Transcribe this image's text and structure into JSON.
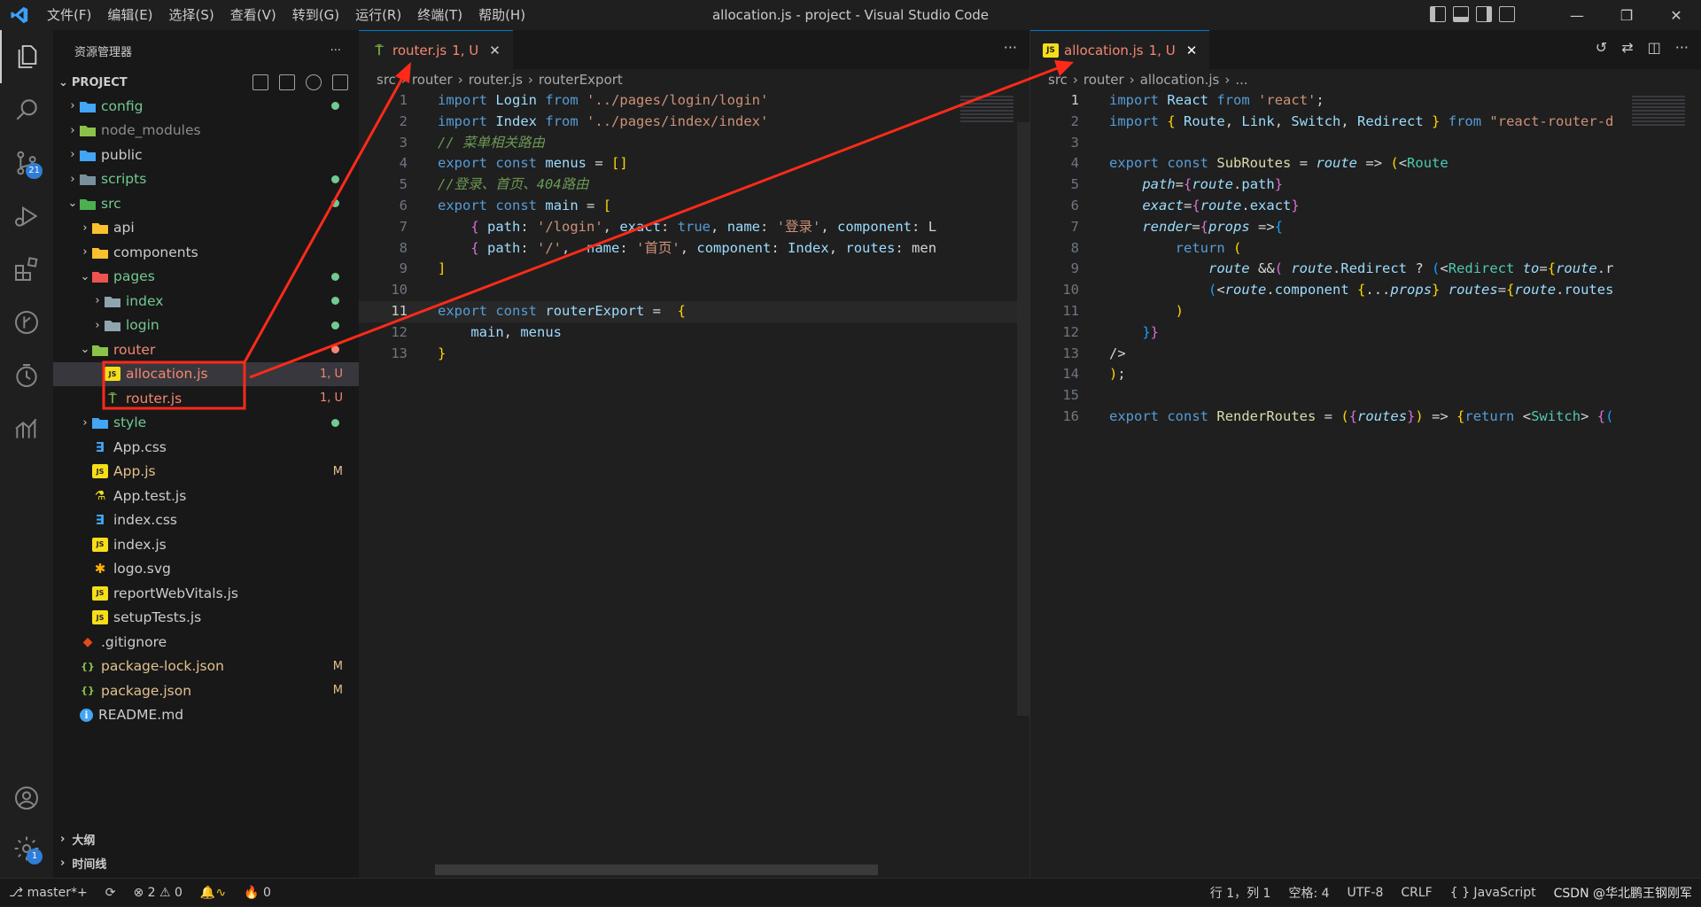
{
  "window": {
    "title": "allocation.js - project - Visual Studio Code"
  },
  "menu": [
    "文件(F)",
    "编辑(E)",
    "选择(S)",
    "查看(V)",
    "转到(G)",
    "运行(R)",
    "终端(T)",
    "帮助(H)"
  ],
  "activity": {
    "scm_badge": "21",
    "settings_badge": "1"
  },
  "sidebar": {
    "header": "资源管理器",
    "more": "···",
    "project": "PROJECT",
    "tree": [
      {
        "label": "config",
        "depth": 0,
        "kind": "folder",
        "open": false,
        "color": "#73c991",
        "icon_color": "#42a5f5",
        "status": "dot",
        "status_color": "#73c991"
      },
      {
        "label": "node_modules",
        "depth": 0,
        "kind": "folder",
        "open": false,
        "color": "#8b8b8b",
        "icon_color": "#8bc34a",
        "status": "",
        "status_color": ""
      },
      {
        "label": "public",
        "depth": 0,
        "kind": "folder",
        "open": false,
        "color": "#cccccc",
        "icon_color": "#42a5f5",
        "status": "",
        "status_color": ""
      },
      {
        "label": "scripts",
        "depth": 0,
        "kind": "folder",
        "open": false,
        "color": "#73c991",
        "icon_color": "#78909c",
        "status": "dot",
        "status_color": "#73c991"
      },
      {
        "label": "src",
        "depth": 0,
        "kind": "folder",
        "open": true,
        "color": "#73c991",
        "icon_color": "#4caf50",
        "status": "dot",
        "status_color": "#73c991"
      },
      {
        "label": "api",
        "depth": 1,
        "kind": "folder",
        "open": false,
        "color": "#cccccc",
        "icon_color": "#fbc02d",
        "status": "",
        "status_color": ""
      },
      {
        "label": "components",
        "depth": 1,
        "kind": "folder",
        "open": false,
        "color": "#cccccc",
        "icon_color": "#fbc02d",
        "status": "",
        "status_color": ""
      },
      {
        "label": "pages",
        "depth": 1,
        "kind": "folder",
        "open": true,
        "color": "#73c991",
        "icon_color": "#ef5350",
        "status": "dot",
        "status_color": "#73c991"
      },
      {
        "label": "index",
        "depth": 2,
        "kind": "folder",
        "open": false,
        "color": "#73c991",
        "icon_color": "#90a4ae",
        "status": "dot",
        "status_color": "#73c991"
      },
      {
        "label": "login",
        "depth": 2,
        "kind": "folder",
        "open": false,
        "color": "#73c991",
        "icon_color": "#90a4ae",
        "status": "dot",
        "status_color": "#73c991"
      },
      {
        "label": "router",
        "depth": 1,
        "kind": "folder",
        "open": true,
        "color": "#f48771",
        "icon_color": "#8bc34a",
        "status": "dot",
        "status_color": "#f48771"
      },
      {
        "label": "allocation.js",
        "depth": 2,
        "kind": "js",
        "open": false,
        "color": "#f48771",
        "icon_color": "#f5de19",
        "status": "1, U",
        "status_color": "#f48771",
        "selected": true
      },
      {
        "label": "router.js",
        "depth": 2,
        "kind": "router",
        "open": false,
        "color": "#f48771",
        "icon_color": "#8bc34a",
        "status": "1, U",
        "status_color": "#f48771"
      },
      {
        "label": "style",
        "depth": 1,
        "kind": "folder",
        "open": false,
        "color": "#73c991",
        "icon_color": "#42a5f5",
        "status": "dot",
        "status_color": "#73c991"
      },
      {
        "label": "App.css",
        "depth": 1,
        "kind": "css",
        "open": false,
        "color": "#cccccc",
        "icon_color": "#42a5f5",
        "status": "",
        "status_color": ""
      },
      {
        "label": "App.js",
        "depth": 1,
        "kind": "js",
        "open": false,
        "color": "#e2c08d",
        "icon_color": "#f5de19",
        "status": "M",
        "status_color": "#e2c08d"
      },
      {
        "label": "App.test.js",
        "depth": 1,
        "kind": "test",
        "open": false,
        "color": "#cccccc",
        "icon_color": "#f5de19",
        "status": "",
        "status_color": ""
      },
      {
        "label": "index.css",
        "depth": 1,
        "kind": "css",
        "open": false,
        "color": "#cccccc",
        "icon_color": "#42a5f5",
        "status": "",
        "status_color": ""
      },
      {
        "label": "index.js",
        "depth": 1,
        "kind": "js",
        "open": false,
        "color": "#cccccc",
        "icon_color": "#f5de19",
        "status": "",
        "status_color": ""
      },
      {
        "label": "logo.svg",
        "depth": 1,
        "kind": "svg",
        "open": false,
        "color": "#cccccc",
        "icon_color": "#ffb300",
        "status": "",
        "status_color": ""
      },
      {
        "label": "reportWebVitals.js",
        "depth": 1,
        "kind": "js",
        "open": false,
        "color": "#cccccc",
        "icon_color": "#f5de19",
        "status": "",
        "status_color": ""
      },
      {
        "label": "setupTests.js",
        "depth": 1,
        "kind": "js",
        "open": false,
        "color": "#cccccc",
        "icon_color": "#f5de19",
        "status": "",
        "status_color": ""
      },
      {
        "label": ".gitignore",
        "depth": 0,
        "kind": "git",
        "open": false,
        "color": "#cccccc",
        "icon_color": "#e64a19",
        "status": "",
        "status_color": ""
      },
      {
        "label": "package-lock.json",
        "depth": 0,
        "kind": "json",
        "open": false,
        "color": "#e2c08d",
        "icon_color": "#8bc34a",
        "status": "M",
        "status_color": "#e2c08d"
      },
      {
        "label": "package.json",
        "depth": 0,
        "kind": "json",
        "open": false,
        "color": "#e2c08d",
        "icon_color": "#8bc34a",
        "status": "M",
        "status_color": "#e2c08d"
      },
      {
        "label": "README.md",
        "depth": 0,
        "kind": "info",
        "open": false,
        "color": "#cccccc",
        "icon_color": "#42a5f5",
        "status": "",
        "status_color": ""
      }
    ],
    "outline": "大纲",
    "timeline": "时间线"
  },
  "editor1": {
    "tab": {
      "icon": "router-icon",
      "label": "router.js",
      "status": "1, U",
      "close": "✕"
    },
    "more": "···",
    "breadcrumbs": [
      "src",
      "router",
      "router.js",
      "routerExport"
    ],
    "lines": [
      [
        [
          "kw",
          "import"
        ],
        [
          "pn",
          " "
        ],
        [
          "var",
          "Login"
        ],
        [
          "pn",
          " "
        ],
        [
          "kw",
          "from"
        ],
        [
          "pn",
          " "
        ],
        [
          "str",
          "'../pages/login/login'"
        ]
      ],
      [
        [
          "kw",
          "import"
        ],
        [
          "pn",
          " "
        ],
        [
          "var",
          "Index"
        ],
        [
          "pn",
          " "
        ],
        [
          "kw",
          "from"
        ],
        [
          "pn",
          " "
        ],
        [
          "str",
          "'../pages/index/index'"
        ]
      ],
      [
        [
          "cm",
          "// 菜单相关路由"
        ]
      ],
      [
        [
          "kw",
          "export"
        ],
        [
          "pn",
          " "
        ],
        [
          "kw",
          "const"
        ],
        [
          "pn",
          " "
        ],
        [
          "var",
          "menus"
        ],
        [
          "pn",
          " = "
        ],
        [
          "br",
          "[]"
        ]
      ],
      [
        [
          "cm",
          "//登录、首页、404路由"
        ]
      ],
      [
        [
          "kw",
          "export"
        ],
        [
          "pn",
          " "
        ],
        [
          "kw",
          "const"
        ],
        [
          "pn",
          " "
        ],
        [
          "var",
          "main"
        ],
        [
          "pn",
          " = "
        ],
        [
          "br",
          "["
        ]
      ],
      [
        [
          "pn",
          "    "
        ],
        [
          "br2",
          "{"
        ],
        [
          "pn",
          " "
        ],
        [
          "var",
          "path"
        ],
        [
          "pn",
          ": "
        ],
        [
          "str",
          "'/login'"
        ],
        [
          "pn",
          ", "
        ],
        [
          "var",
          "exact"
        ],
        [
          "pn",
          ": "
        ],
        [
          "kw",
          "true"
        ],
        [
          "pn",
          ", "
        ],
        [
          "var",
          "name"
        ],
        [
          "pn",
          ": "
        ],
        [
          "str",
          "'登录'"
        ],
        [
          "pn",
          ", "
        ],
        [
          "var",
          "component"
        ],
        [
          "pn",
          ": L"
        ]
      ],
      [
        [
          "pn",
          "    "
        ],
        [
          "br2",
          "{"
        ],
        [
          "pn",
          " "
        ],
        [
          "var",
          "path"
        ],
        [
          "pn",
          ": "
        ],
        [
          "str",
          "'/'"
        ],
        [
          "pn",
          ",  "
        ],
        [
          "var",
          "name"
        ],
        [
          "pn",
          ": "
        ],
        [
          "str",
          "'首页'"
        ],
        [
          "pn",
          ", "
        ],
        [
          "var",
          "component"
        ],
        [
          "pn",
          ": "
        ],
        [
          "var",
          "Index"
        ],
        [
          "pn",
          ", "
        ],
        [
          "var",
          "routes"
        ],
        [
          "pn",
          ": men"
        ]
      ],
      [
        [
          "br",
          "]"
        ]
      ],
      [
        [
          "pn",
          ""
        ]
      ],
      [
        [
          "kw",
          "export"
        ],
        [
          "pn",
          " "
        ],
        [
          "kw",
          "const"
        ],
        [
          "pn",
          " "
        ],
        [
          "var",
          "routerExport"
        ],
        [
          "pn",
          " =  "
        ],
        [
          "br",
          "{"
        ]
      ],
      [
        [
          "pn",
          "    "
        ],
        [
          "var",
          "main"
        ],
        [
          "pn",
          ", "
        ],
        [
          "var",
          "menus"
        ]
      ],
      [
        [
          "br",
          "}"
        ]
      ]
    ]
  },
  "editor2": {
    "tab": {
      "icon": "js-icon",
      "label": "allocation.js",
      "status": "1, U",
      "close": "✕"
    },
    "breadcrumbs": [
      "src",
      "router",
      "allocation.js",
      "..."
    ],
    "lines": [
      [
        [
          "kw",
          "import"
        ],
        [
          "pn",
          " "
        ],
        [
          "var",
          "React"
        ],
        [
          "pn",
          " "
        ],
        [
          "kw",
          "from"
        ],
        [
          "pn",
          " "
        ],
        [
          "str",
          "'react'"
        ],
        [
          "pn",
          ";"
        ]
      ],
      [
        [
          "kw",
          "import"
        ],
        [
          "pn",
          " "
        ],
        [
          "br",
          "{"
        ],
        [
          "pn",
          " "
        ],
        [
          "var",
          "Route"
        ],
        [
          "pn",
          ", "
        ],
        [
          "var",
          "Link"
        ],
        [
          "pn",
          ", "
        ],
        [
          "var",
          "Switch"
        ],
        [
          "pn",
          ", "
        ],
        [
          "var",
          "Redirect"
        ],
        [
          "pn",
          " "
        ],
        [
          "br",
          "}"
        ],
        [
          "pn",
          " "
        ],
        [
          "kw",
          "from"
        ],
        [
          "pn",
          " "
        ],
        [
          "str",
          "\"react-router-d"
        ]
      ],
      [
        [
          "pn",
          ""
        ]
      ],
      [
        [
          "kw",
          "export"
        ],
        [
          "pn",
          " "
        ],
        [
          "kw",
          "const"
        ],
        [
          "pn",
          " "
        ],
        [
          "fn",
          "SubRoutes"
        ],
        [
          "pn",
          " = "
        ],
        [
          "it",
          "route"
        ],
        [
          "pn",
          " => "
        ],
        [
          "br",
          "("
        ],
        [
          "pn",
          "<"
        ],
        [
          "ty",
          "Route"
        ]
      ],
      [
        [
          "pn",
          "    "
        ],
        [
          "it",
          "path"
        ],
        [
          "pn",
          "="
        ],
        [
          "br2",
          "{"
        ],
        [
          "it",
          "route"
        ],
        [
          "pn",
          "."
        ],
        [
          "var",
          "path"
        ],
        [
          "br2",
          "}"
        ]
      ],
      [
        [
          "pn",
          "    "
        ],
        [
          "it",
          "exact"
        ],
        [
          "pn",
          "="
        ],
        [
          "br2",
          "{"
        ],
        [
          "it",
          "route"
        ],
        [
          "pn",
          "."
        ],
        [
          "var",
          "exact"
        ],
        [
          "br2",
          "}"
        ]
      ],
      [
        [
          "pn",
          "    "
        ],
        [
          "it",
          "render"
        ],
        [
          "pn",
          "="
        ],
        [
          "br2",
          "{"
        ],
        [
          "it",
          "props"
        ],
        [
          "pn",
          " =>"
        ],
        [
          "br3",
          "{"
        ]
      ],
      [
        [
          "pn",
          "        "
        ],
        [
          "kw",
          "return"
        ],
        [
          "pn",
          " "
        ],
        [
          "br",
          "("
        ]
      ],
      [
        [
          "pn",
          "            "
        ],
        [
          "it",
          "route"
        ],
        [
          "pn",
          " &&"
        ],
        [
          "br2",
          "("
        ],
        [
          "pn",
          " "
        ],
        [
          "it",
          "route"
        ],
        [
          "pn",
          "."
        ],
        [
          "var",
          "Redirect"
        ],
        [
          "pn",
          " ? "
        ],
        [
          "br3",
          "("
        ],
        [
          "pn",
          "<"
        ],
        [
          "ty",
          "Redirect"
        ],
        [
          "pn",
          " "
        ],
        [
          "it",
          "to"
        ],
        [
          "pn",
          "="
        ],
        [
          "br",
          "{"
        ],
        [
          "it",
          "route"
        ],
        [
          "pn",
          ".r"
        ]
      ],
      [
        [
          "pn",
          "            "
        ],
        [
          "br3",
          "("
        ],
        [
          "pn",
          "<"
        ],
        [
          "it",
          "route"
        ],
        [
          "pn",
          "."
        ],
        [
          "var",
          "component"
        ],
        [
          "pn",
          " "
        ],
        [
          "br",
          "{"
        ],
        [
          "pn",
          "..."
        ],
        [
          "it",
          "props"
        ],
        [
          "br",
          "}"
        ],
        [
          "pn",
          " "
        ],
        [
          "it",
          "routes"
        ],
        [
          "pn",
          "="
        ],
        [
          "br",
          "{"
        ],
        [
          "it",
          "route"
        ],
        [
          "pn",
          "."
        ],
        [
          "var",
          "routes"
        ]
      ],
      [
        [
          "pn",
          "        "
        ],
        [
          "br",
          ")"
        ]
      ],
      [
        [
          "pn",
          "    "
        ],
        [
          "br3",
          "}"
        ],
        [
          "br2",
          "}"
        ]
      ],
      [
        [
          "pn",
          "/>"
        ]
      ],
      [
        [
          "br",
          ")"
        ],
        [
          "pn",
          ";"
        ]
      ],
      [
        [
          "pn",
          ""
        ]
      ],
      [
        [
          "kw",
          "export"
        ],
        [
          "pn",
          " "
        ],
        [
          "kw",
          "const"
        ],
        [
          "pn",
          " "
        ],
        [
          "fn",
          "RenderRoutes"
        ],
        [
          "pn",
          " = "
        ],
        [
          "br",
          "("
        ],
        [
          "br2",
          "{"
        ],
        [
          "it",
          "routes"
        ],
        [
          "br2",
          "}"
        ],
        [
          "br",
          ")"
        ],
        [
          "pn",
          " => "
        ],
        [
          "br",
          "{"
        ],
        [
          "kw",
          "return"
        ],
        [
          "pn",
          " <"
        ],
        [
          "ty",
          "Switch"
        ],
        [
          "pn",
          "> "
        ],
        [
          "br2",
          "{"
        ],
        [
          "br3",
          "("
        ]
      ]
    ]
  },
  "status": {
    "branch": "master*+",
    "sync": "",
    "errors": "2",
    "warnings": "0",
    "ports": "0",
    "position": "行 1，列 1",
    "spaces": "空格: 4",
    "encoding": "UTF-8",
    "eol": "CRLF",
    "language": "{ } JavaScript",
    "watermark": "CSDN @华北鹏王钢刚军"
  },
  "colors": {
    "annotation": "#ff2a1a",
    "accent": "#0078d4"
  }
}
